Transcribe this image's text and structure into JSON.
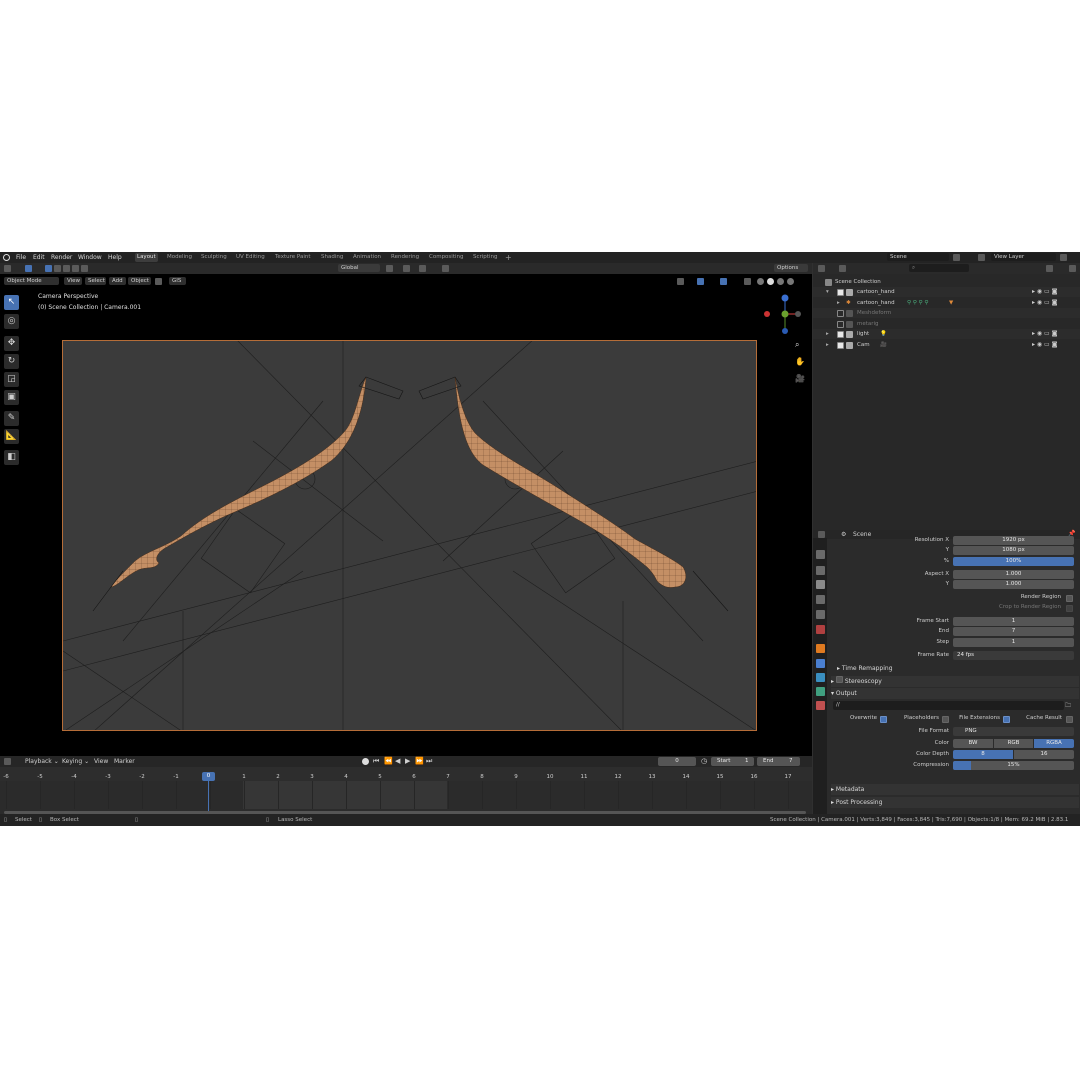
{
  "menu": [
    "File",
    "Edit",
    "Render",
    "Window",
    "Help"
  ],
  "workspaces": [
    "Layout",
    "Modeling",
    "Sculpting",
    "UV Editing",
    "Texture Paint",
    "Shading",
    "Animation",
    "Rendering",
    "Compositing",
    "Scripting"
  ],
  "scene_field": "Scene",
  "view_layer_field": "View Layer",
  "header": {
    "orientation": "Global",
    "options": "Options",
    "mode": "Object Mode",
    "view": "View",
    "select": "Select",
    "add": "Add",
    "object": "Object",
    "gis": "GIS"
  },
  "viewport": {
    "camera_label": "Camera Perspective",
    "collection_label": "(0) Scene Collection | Camera.001"
  },
  "outliner": {
    "root": "Scene Collection",
    "rows": [
      {
        "name": "cartoon_hand",
        "enabled": true
      },
      {
        "name": "cartoon_hand",
        "enabled": true
      },
      {
        "name": "Meshdeform",
        "enabled": false
      },
      {
        "name": "metarig",
        "enabled": false
      },
      {
        "name": "light",
        "enabled": true
      },
      {
        "name": "Cam",
        "enabled": true
      }
    ]
  },
  "properties": {
    "context": "Scene",
    "resolution_x_label": "Resolution X",
    "resolution_x": "1920 px",
    "y_label": "Y",
    "resolution_y": "1080 px",
    "percent_label": "%",
    "percent": "100%",
    "aspect_x_label": "Aspect X",
    "aspect_x": "1.000",
    "aspect_y": "1.000",
    "render_region": "Render Region",
    "crop_region": "Crop to Render Region",
    "frame_start_label": "Frame Start",
    "frame_start": "1",
    "end_label": "End",
    "frame_end": "7",
    "step_label": "Step",
    "step": "1",
    "frame_rate_label": "Frame Rate",
    "frame_rate": "24 fps",
    "time_remapping": "Time Remapping",
    "stereoscopy": "Stereoscopy",
    "output": "Output",
    "output_path": "//",
    "overwrite": "Overwrite",
    "placeholders": "Placeholders",
    "file_extensions": "File Extensions",
    "cache_result": "Cache Result",
    "file_format_label": "File Format",
    "file_format": "PNG",
    "color_label": "Color",
    "color_options": [
      "BW",
      "RGB",
      "RGBA"
    ],
    "color_depth_label": "Color Depth",
    "depth_options": [
      "8",
      "16"
    ],
    "compression_label": "Compression",
    "compression": "15%",
    "compression_fraction": 0.15,
    "metadata": "Metadata",
    "post_processing": "Post Processing"
  },
  "timeline": {
    "playback": "Playback",
    "keying": "Keying",
    "view": "View",
    "marker": "Marker",
    "current_frame": "0",
    "start_label": "Start",
    "start": "1",
    "end_label": "End",
    "end": "7",
    "ticks": [
      "-6",
      "-5",
      "-4",
      "-3",
      "-2",
      "-1",
      "0",
      "1",
      "2",
      "3",
      "4",
      "5",
      "6",
      "7",
      "8",
      "9",
      "10",
      "11",
      "12",
      "13",
      "14",
      "15",
      "16",
      "17"
    ]
  },
  "status": {
    "select": "Select",
    "box_select": "Box Select",
    "lasso_select": "Lasso Select",
    "info": "Scene Collection | Camera.001 | Verts:3,849 | Faces:3,845 | Tris:7,690 | Objects:1/8 | Mem: 69.2 MiB | 2.83.1"
  },
  "colors": {
    "accent": "#4772b3",
    "camera_border": "#b56d38",
    "skin": "#c8946a"
  }
}
